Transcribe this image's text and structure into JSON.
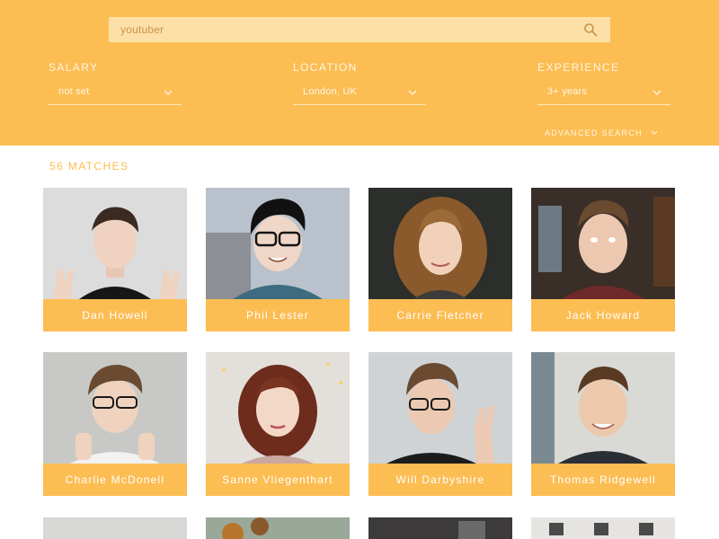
{
  "colors": {
    "accent": "#fcbd53",
    "search_bg": "#fde0a8",
    "text_light": "#fff6e4"
  },
  "search": {
    "value": "youtuber",
    "icon": "search-icon"
  },
  "filters": [
    {
      "label": "SALARY",
      "value": "not set"
    },
    {
      "label": "LOCATION",
      "value": "London, UK"
    },
    {
      "label": "EXPERIENCE",
      "value": "3+ years"
    }
  ],
  "advanced_search": {
    "label": "ADVANCED SEARCH"
  },
  "results": {
    "count_label": "56 MATCHES",
    "people": [
      {
        "name": "Dan Howell"
      },
      {
        "name": "Phil Lester"
      },
      {
        "name": "Carrie Fletcher"
      },
      {
        "name": "Jack Howard"
      },
      {
        "name": "Charlie McDonell"
      },
      {
        "name": "Sanne Vliegenthart"
      },
      {
        "name": "Will Darbyshire"
      },
      {
        "name": "Thomas Ridgewell"
      }
    ]
  }
}
